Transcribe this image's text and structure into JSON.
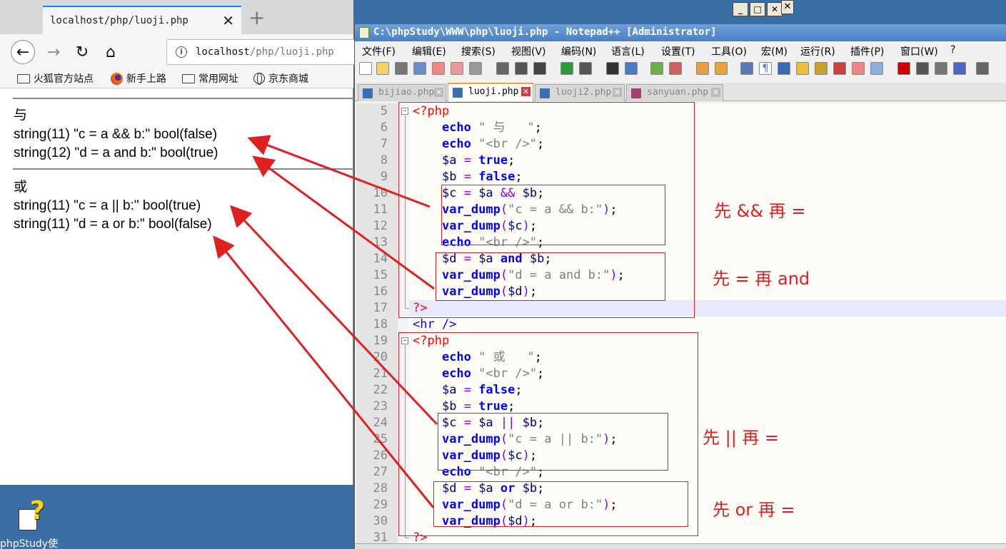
{
  "browser": {
    "tab_title": "localhost/php/luoji.php",
    "tab_close": "✕",
    "new_tab": "+",
    "url_host": "localhost",
    "url_path": "/php/luoji.php",
    "bookmarks": [
      {
        "label": "火狐官方站点",
        "icon": "folder-icon"
      },
      {
        "label": "新手上路",
        "icon": "firefox-icon"
      },
      {
        "label": "常用网址",
        "icon": "folder-icon"
      },
      {
        "label": "京东商城",
        "icon": "globe-icon"
      }
    ],
    "output": {
      "and_heading": "与",
      "and_line1": "string(11) \"c = a && b:\" bool(false)",
      "and_line2": "string(12) \"d = a and b:\" bool(true)",
      "or_heading": "或",
      "or_line1": "string(11) \"c = a || b:\" bool(true)",
      "or_line2": "string(11) \"d = a or b:\" bool(false)"
    }
  },
  "editor": {
    "title": "C:\\phpStudy\\WWW\\php\\luoji.php - Notepad++ [Administrator]",
    "menu": [
      "文件(F)",
      "编辑(E)",
      "搜索(S)",
      "视图(V)",
      "编码(N)",
      "语言(L)",
      "设置(T)",
      "工具(O)",
      "宏(M)",
      "运行(R)",
      "插件(P)",
      "窗口(W)",
      "?"
    ],
    "tabs": [
      {
        "label": "bijiao.php",
        "active": false
      },
      {
        "label": "luoji.php",
        "active": true
      },
      {
        "label": "luoji2.php",
        "active": false
      },
      {
        "label": "sanyuan.php",
        "active": false
      }
    ],
    "line_numbers": [
      "5",
      "6",
      "7",
      "8",
      "9",
      "10",
      "11",
      "12",
      "13",
      "14",
      "15",
      "16",
      "17",
      "18",
      "19",
      "20",
      "21",
      "22",
      "23",
      "24",
      "25",
      "26",
      "27",
      "28",
      "29",
      "30",
      "31"
    ]
  },
  "annotations": {
    "note1": "先 && 再 =",
    "note2": "先 = 再 and",
    "note3": "先 || 再 =",
    "note4": "先 or 再 ="
  },
  "desktop": {
    "icon_label": "phpStudy使"
  },
  "colors": {
    "annotation": "#e02020",
    "keyword": "#0000ff",
    "php_tag": "#ff0000",
    "string": "#808080"
  }
}
